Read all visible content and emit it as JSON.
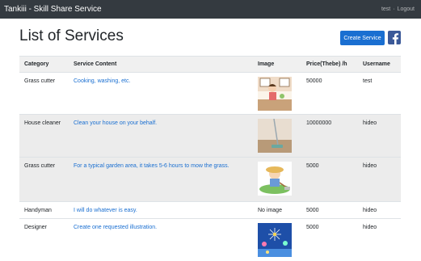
{
  "navbar": {
    "brand": "Tankiii - Skill Share Service",
    "user": "test",
    "separator": "·",
    "logout": "Logout"
  },
  "page": {
    "title": "List of Services",
    "create_button": "Create Service",
    "facebook_icon": "facebook-icon"
  },
  "table": {
    "headers": [
      "Category",
      "Service Content",
      "Image",
      "Price(Thebe) /h",
      "Username"
    ],
    "rows": [
      {
        "category": "Grass cutter",
        "content": "Cooking, washing, etc.",
        "image": "kitchen-illustration",
        "image_text": "",
        "price": "50000",
        "username": "test"
      },
      {
        "category": "House cleaner",
        "content": "Clean your house on your behalf.",
        "image": "mop-photo",
        "image_text": "",
        "price": "10000000",
        "username": "hideo"
      },
      {
        "category": "Grass cutter",
        "content": "For a typical garden area, it takes 5-6 hours to mow the grass.",
        "image": "grass-cutting-illustration",
        "image_text": "",
        "price": "5000",
        "username": "hideo"
      },
      {
        "category": "Handyman",
        "content": "I will do whatever is easy.",
        "image": "none",
        "image_text": "No image",
        "price": "5000",
        "username": "hideo"
      },
      {
        "category": "Designer",
        "content": "Create one requested illustration.",
        "image": "fireworks-illustration",
        "image_text": "",
        "price": "5000",
        "username": "hideo"
      }
    ]
  }
}
